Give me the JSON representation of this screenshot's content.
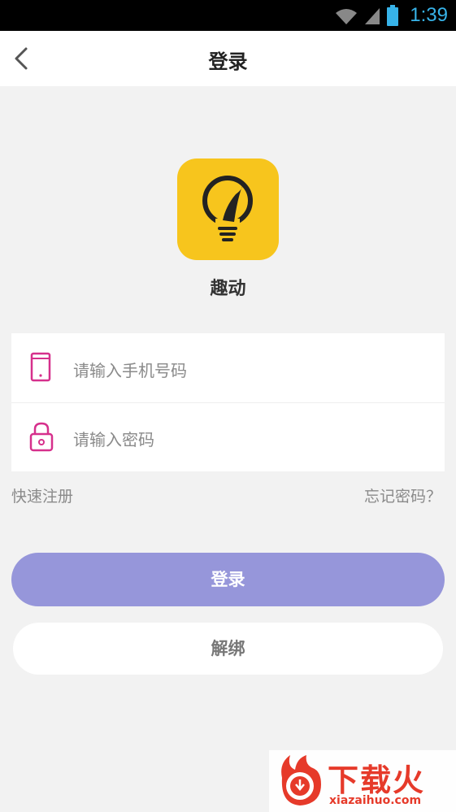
{
  "status_bar": {
    "time": "1:39",
    "icons": [
      "wifi-icon",
      "signal-icon",
      "battery-icon"
    ],
    "accent_color": "#37b3e9"
  },
  "nav": {
    "title": "登录",
    "back_icon": "chevron-left-icon"
  },
  "app": {
    "name": "趣动",
    "icon": "lightbulb-icon",
    "icon_bg": "#f7c51d"
  },
  "form": {
    "phone_placeholder": "请输入手机号码",
    "password_placeholder": "请输入密码",
    "phone_icon": "phone-icon",
    "password_icon": "lock-icon",
    "icon_color": "#d6308c"
  },
  "links": {
    "register": "快速注册",
    "forgot": "忘记密码？"
  },
  "buttons": {
    "login": "登录",
    "login_color": "#9696da",
    "unbind": "解绑"
  },
  "watermark": {
    "title": "下载火",
    "url": "xiazaihuo.com"
  }
}
